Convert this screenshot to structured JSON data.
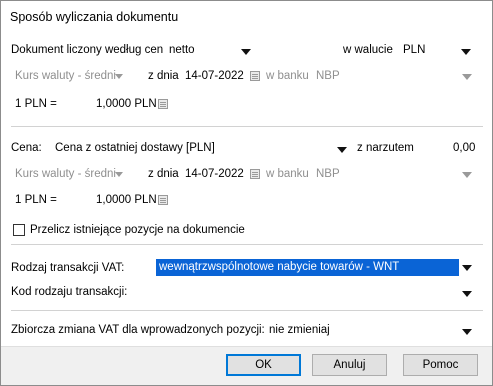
{
  "window": {
    "title": "Sposób wyliczania dokumentu"
  },
  "row_doc": {
    "label": "Dokument liczony według cen",
    "price_type": "netto",
    "currency_label": "w walucie",
    "currency": "PLN"
  },
  "row_rate1": {
    "rate_label": "Kurs waluty - średni",
    "date_label": "z dnia",
    "date": "14-07-2022",
    "bank_label": "w banku",
    "bank": "NBP"
  },
  "row_conv1": {
    "lhs": "1 PLN =",
    "rhs": "1,0000 PLN"
  },
  "row_price": {
    "label": "Cena:",
    "value": "Cena z ostatniej dostawy [PLN]",
    "markup_label": "z narzutem",
    "markup": "0,00"
  },
  "row_rate2": {
    "rate_label": "Kurs waluty - średni",
    "date_label": "z dnia",
    "date": "14-07-2022",
    "bank_label": "w banku",
    "bank": "NBP"
  },
  "row_conv2": {
    "lhs": "1 PLN =",
    "rhs": "1,0000 PLN"
  },
  "recalc": {
    "label": "Przelicz istniejące pozycje na dokumencie",
    "checked": false
  },
  "vat": {
    "transaction_label": "Rodzaj transakcji VAT:",
    "transaction_value": "wewnątrzwspólnotowe nabycie towarów - WNT",
    "code_label": "Kod rodzaju transakcji:",
    "code_value": ""
  },
  "bulk_vat": {
    "label": "Zbiorcza zmiana VAT dla wprowadzonych pozycji:",
    "value": "nie zmieniaj"
  },
  "buttons": {
    "ok": "OK",
    "cancel": "Anuluj",
    "help": "Pomoc"
  },
  "colors": {
    "selection": "#0a64d6",
    "default_button_border": "#0078d7"
  }
}
